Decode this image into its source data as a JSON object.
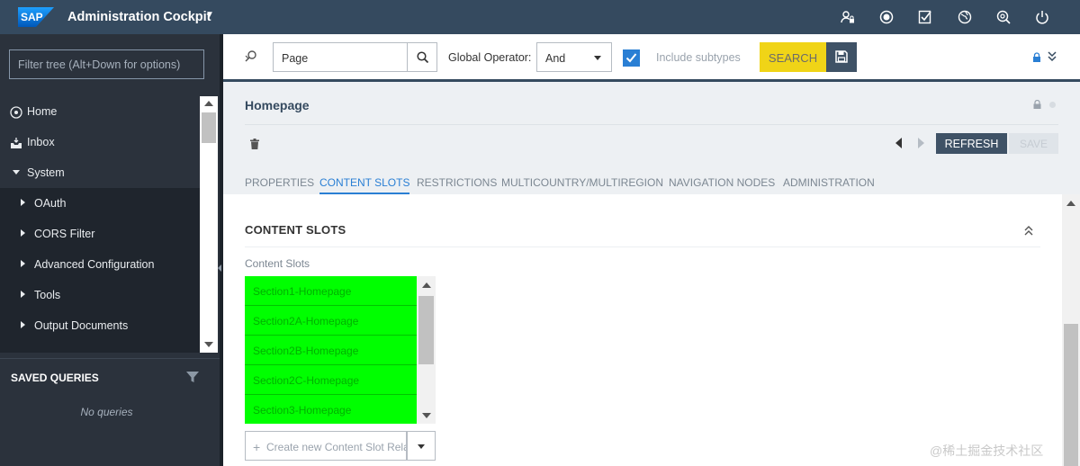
{
  "header": {
    "logo": "SAP",
    "app_title": "Administration Cockpit",
    "icons": [
      "user-lock-icon",
      "notification-icon",
      "tasks-icon",
      "globe-icon",
      "help-search-icon",
      "power-icon"
    ]
  },
  "left_panel": {
    "filter_placeholder": "Filter tree (Alt+Down for options)",
    "tree": [
      {
        "label": "Home",
        "icon": "home-icon"
      },
      {
        "label": "Inbox",
        "icon": "inbox-icon"
      },
      {
        "label": "System",
        "expanded": true
      },
      {
        "label": "OAuth"
      },
      {
        "label": "CORS Filter"
      },
      {
        "label": "Advanced Configuration"
      },
      {
        "label": "Tools"
      },
      {
        "label": "Output Documents"
      }
    ],
    "saved_queries_title": "SAVED QUERIES",
    "no_queries": "No queries"
  },
  "searchbar": {
    "type_value": "Page",
    "global_operator_label": "Global Operator:",
    "global_operator_value": "And",
    "include_subtypes_label": "Include subtypes",
    "include_subtypes_checked": true,
    "search_label": "SEARCH"
  },
  "editor": {
    "title": "Homepage",
    "refresh_label": "REFRESH",
    "save_label": "SAVE",
    "tabs": [
      "PROPERTIES",
      "CONTENT SLOTS",
      "RESTRICTIONS",
      "MULTICOUNTRY/MULTIREGION",
      "NAVIGATION NODES",
      "ADMINISTRATION"
    ],
    "active_tab": "CONTENT SLOTS",
    "section_title": "CONTENT SLOTS",
    "field_label": "Content Slots",
    "content_slots": [
      "Section1-Homepage",
      "Section2A-Homepage",
      "Section2B-Homepage",
      "Section2C-Homepage",
      "Section3-Homepage"
    ],
    "create_placeholder": "Create new Content Slot Rela"
  },
  "colors": {
    "shell": "#354a5f",
    "sidebar": "#2b323c",
    "accent": "#2a7fd4",
    "search_button": "#f0d417",
    "slot_highlight": "#00ff00"
  },
  "watermark": "@稀土掘金技术社区"
}
